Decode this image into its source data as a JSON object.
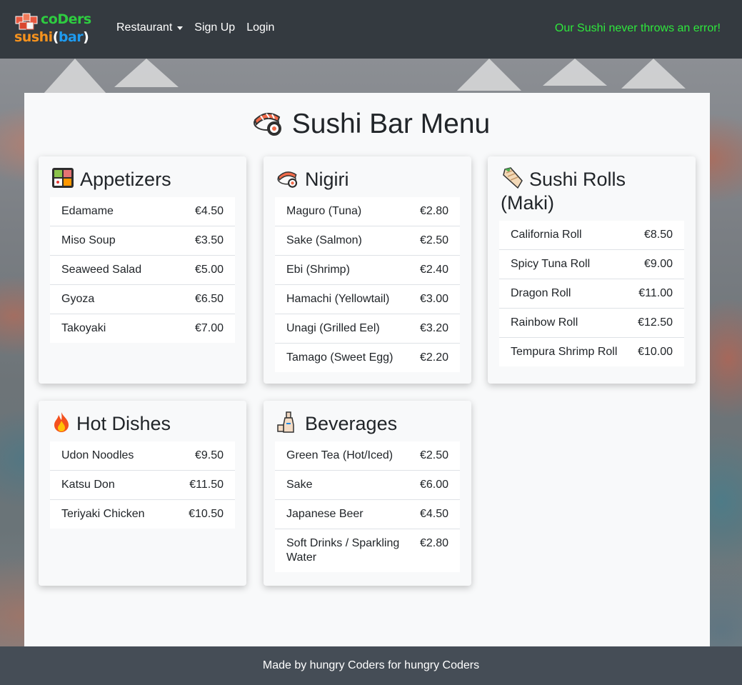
{
  "navbar": {
    "brand": {
      "line1": "coDers",
      "line2_a": "sushi",
      "line2_open": "(",
      "line2_b": "bar",
      "line2_close": ")"
    },
    "links": {
      "restaurant": "Restaurant",
      "signup": "Sign Up",
      "login": "Login"
    },
    "tagline": "Our Sushi never throws an error!"
  },
  "page": {
    "title": "Sushi Bar Menu",
    "title_icon": "sushi-icon"
  },
  "categories": {
    "appetizers": {
      "title": "Appetizers",
      "icon": "bento-box-icon",
      "items": [
        {
          "name": "Edamame",
          "price": "€4.50"
        },
        {
          "name": "Miso Soup",
          "price": "€3.50"
        },
        {
          "name": "Seaweed Salad",
          "price": "€5.00"
        },
        {
          "name": "Gyoza",
          "price": "€6.50"
        },
        {
          "name": "Takoyaki",
          "price": "€7.00"
        }
      ]
    },
    "nigiri": {
      "title": "Nigiri",
      "icon": "sushi-icon",
      "items": [
        {
          "name": "Maguro (Tuna)",
          "price": "€2.80"
        },
        {
          "name": "Sake (Salmon)",
          "price": "€2.50"
        },
        {
          "name": "Ebi (Shrimp)",
          "price": "€2.40"
        },
        {
          "name": "Hamachi (Yellowtail)",
          "price": "€3.00"
        },
        {
          "name": "Unagi (Grilled Eel)",
          "price": "€3.20"
        },
        {
          "name": "Tamago (Sweet Egg)",
          "price": "€2.20"
        }
      ]
    },
    "rolls": {
      "title": "Sushi Rolls (Maki)",
      "icon": "burrito-icon",
      "items": [
        {
          "name": "California Roll",
          "price": "€8.50"
        },
        {
          "name": "Spicy Tuna Roll",
          "price": "€9.00"
        },
        {
          "name": "Dragon Roll",
          "price": "€11.00"
        },
        {
          "name": "Rainbow Roll",
          "price": "€12.50"
        },
        {
          "name": "Tempura Shrimp Roll",
          "price": "€10.00"
        }
      ]
    },
    "hot": {
      "title": "Hot Dishes",
      "icon": "fire-icon",
      "items": [
        {
          "name": "Udon Noodles",
          "price": "€9.50"
        },
        {
          "name": "Katsu Don",
          "price": "€11.50"
        },
        {
          "name": "Teriyaki Chicken",
          "price": "€10.50"
        }
      ]
    },
    "beverages": {
      "title": "Beverages",
      "icon": "sake-bottle-icon",
      "items": [
        {
          "name": "Green Tea (Hot/Iced)",
          "price": "€2.50"
        },
        {
          "name": "Sake",
          "price": "€6.00"
        },
        {
          "name": "Japanese Beer",
          "price": "€4.50"
        },
        {
          "name": "Soft Drinks / Sparkling Water",
          "price": "€2.80"
        }
      ]
    }
  },
  "footer": {
    "text": "Made by hungry Coders for hungry Coders"
  },
  "colors": {
    "navbar": "#343a40",
    "tagline": "#2ee83c",
    "brand_green": "#2ecc40",
    "brand_orange": "#f5921e",
    "brand_blue": "#1e9bf0",
    "footer": "#454d56",
    "card": "#f8f9fa"
  }
}
